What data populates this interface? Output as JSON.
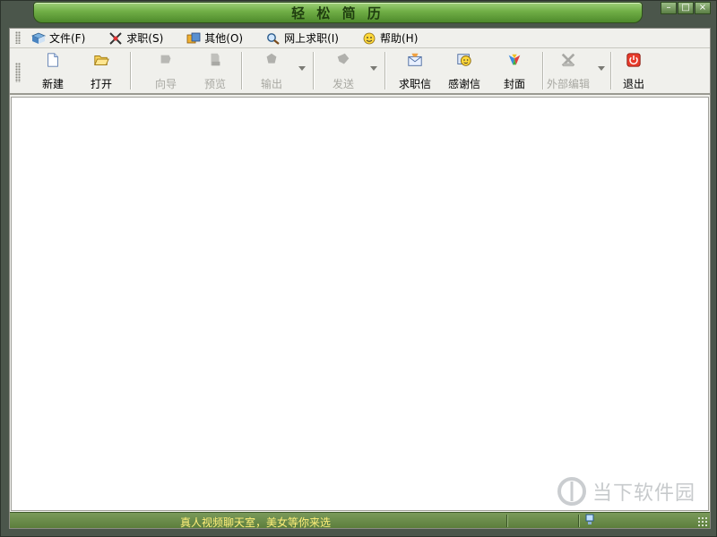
{
  "window": {
    "title": "轻 松 简 历",
    "controls": {
      "minimize": "–",
      "maximize": "□",
      "close": "×"
    }
  },
  "menu": {
    "items": [
      {
        "label": "文件(F)",
        "icon": "file-menu-icon"
      },
      {
        "label": "求职(S)",
        "icon": "job-menu-icon"
      },
      {
        "label": "其他(O)",
        "icon": "other-menu-icon"
      },
      {
        "label": "网上求职(I)",
        "icon": "search-jobs-icon"
      },
      {
        "label": "帮助(H)",
        "icon": "help-icon"
      }
    ]
  },
  "toolbar": {
    "new": "新建",
    "open": "打开",
    "wizard": "向导",
    "preview": "预览",
    "export": "输出",
    "send": "发送",
    "cover_letter": "求职信",
    "thank_letter": "感谢信",
    "cover": "封面",
    "external_editor": "外部编辑",
    "exit": "退出"
  },
  "status": {
    "message": "真人视频聊天室，美女等你来选"
  },
  "watermark": {
    "text": "当下软件园"
  },
  "colors": {
    "title_green": "#6fae45",
    "status_green": "#5c7e3c",
    "status_text": "#ffef7a"
  }
}
